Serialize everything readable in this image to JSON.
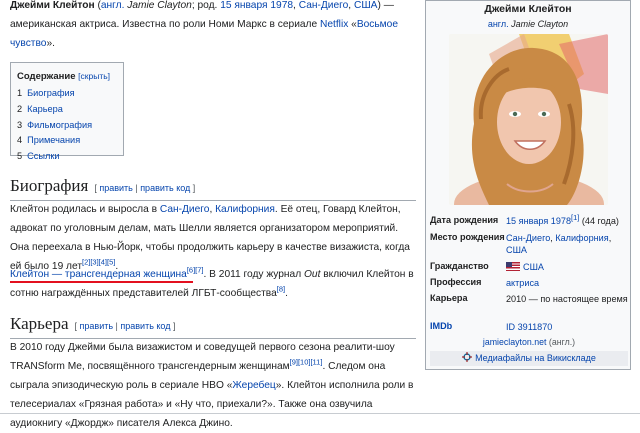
{
  "intro": {
    "name_bold": "Джейми Клейтон",
    "paren_open": " (",
    "lang_link": "англ.",
    "latin_name": "Jamie Clayton",
    "born_prefix": "; род. ",
    "birth_date": "15 января 1978",
    "comma": ", ",
    "city": "Сан-Диего",
    "country": "США",
    "paren_close": ") —",
    "line2": "американская актриса. Известна по роли Номи Маркс в сериале ",
    "netflix": "Netflix",
    "quote_open": " «",
    "series": "Восьмое чувство",
    "quote_close": "»."
  },
  "toc": {
    "title": "Содержание",
    "toggle": "[скрыть]",
    "items": [
      {
        "num": "1",
        "label": "Биография"
      },
      {
        "num": "2",
        "label": "Карьера"
      },
      {
        "num": "3",
        "label": "Фильмография"
      },
      {
        "num": "4",
        "label": "Примечания"
      },
      {
        "num": "5",
        "label": "Ссылки"
      }
    ]
  },
  "bio": {
    "heading": "Биография",
    "edit_open": "[ ",
    "edit_link": "править",
    "edit_sep": " | ",
    "edit_code_link": "править код",
    "edit_close": " ]",
    "p1_a": "Клейтон родилась и выросла в ",
    "p1_sd": "Сан-Диего",
    "p1_comma": ", ",
    "p1_ca": "Калифорния",
    "p1_b": ". Её отец, Говард Клейтон, адвокат по уголовным делам, мать Шелли является организатором мероприятий. Она переехала в Нью-Йорк, чтобы продолжить карьеру в качестве визажиста, когда ей было 19 лет",
    "p1_refs": "[2][3][4][5]",
    "p1_end": ".",
    "p2_link": "Клейтон — трансгендерная женщина",
    "p2_refs": "[6][7]",
    "p2_a": ". В 2011 году журнал ",
    "p2_out": "Out",
    "p2_b": " включил Клейтон в сотню награждённых представителей ЛГБТ-сообщества",
    "p2_ref": "[8]",
    "p2_end": "."
  },
  "career": {
    "heading": "Карьера",
    "edit_open": "[ ",
    "edit_link": "править",
    "edit_sep": " | ",
    "edit_code_link": "править код",
    "edit_close": " ]",
    "p_a": "В 2010 году Джейми была визажистом и соведущей первого сезона реалити-шоу TRANSform Me, посвящённого трансгендерным женщинам",
    "p_refs": "[9][10][11]",
    "p_b": ". Следом она сыграла эпизодическую роль в сериале HBO «",
    "p_stud": "Жеребец",
    "p_c": "». Клейтон исполнила роли в телесериалах «Грязная работа» и «Ну что, приехали?». Также она озвучила аудиокнигу «Джордж» писателя Алекса Джино."
  },
  "infobox": {
    "name": "Джейми Клейтон",
    "lang": "англ.",
    "latin": "Jamie Clayton",
    "birth_label": "Дата рождения",
    "birth_value": "15 января 1978",
    "birth_ref": "[1]",
    "birth_age": " (44 года)",
    "place_label": "Место рождения",
    "place_city": "Сан-Диего",
    "place_state": "Калифорния",
    "place_country": "США",
    "citizen_label": "Гражданство",
    "citizen_value": "США",
    "prof_label": "Профессия",
    "prof_value": "актриса",
    "career_label": "Карьера",
    "career_value": "2010 — по настоящее время",
    "imdb_label": "IMDb",
    "imdb_value": "ID 3911870",
    "site": "jamieclayton.net",
    "site_lang": " (англ.)",
    "commons": "Медиафайлы на Викискладе"
  },
  "colors": {
    "link": "#0645ad",
    "underline": "#e3101f",
    "infobox_bg": "#f8f9fa"
  }
}
